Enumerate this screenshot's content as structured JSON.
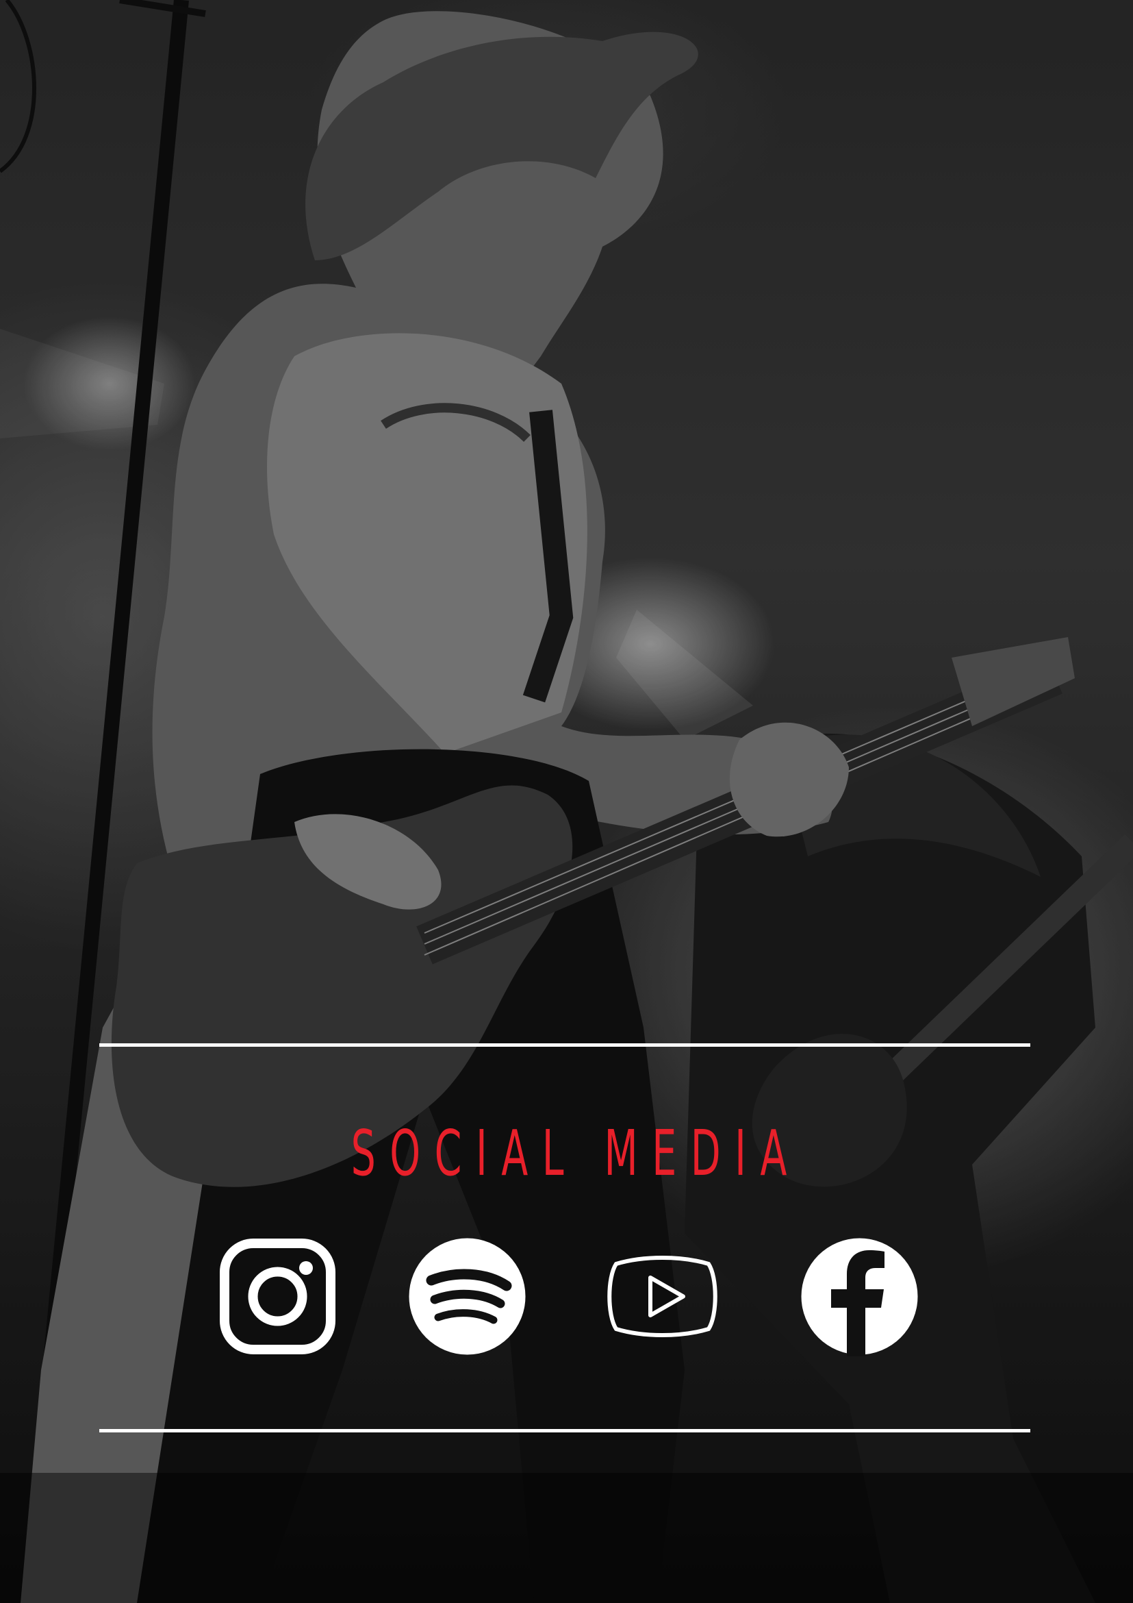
{
  "heading": {
    "text": "SOCIAL MEDIA",
    "color": "#e8202a"
  },
  "social_links": [
    {
      "icon": "instagram-icon"
    },
    {
      "icon": "spotify-icon"
    },
    {
      "icon": "youtube-icon"
    },
    {
      "icon": "facebook-icon"
    }
  ],
  "colors": {
    "accent": "#e8202a",
    "lines": "#ffffff",
    "icons": "#ffffff"
  }
}
